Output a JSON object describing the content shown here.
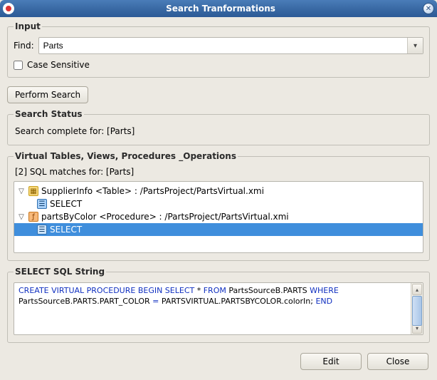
{
  "window": {
    "title": "Search Tranformations"
  },
  "input": {
    "legend": "Input",
    "find_label": "Find:",
    "find_value": "Parts",
    "case_sensitive_label": "Case Sensitive",
    "case_sensitive_checked": false
  },
  "perform_search_label": "Perform Search",
  "status": {
    "legend": "Search Status",
    "text": "Search complete for: [Parts]"
  },
  "results": {
    "legend": "Virtual Tables, Views, Procedures _Operations",
    "summary": "[2] SQL matches for: [Parts]",
    "items": [
      {
        "label": "SupplierInfo <Table>   : /PartsProject/PartsVirtual.xmi",
        "child_label": "SELECT",
        "icon": "table"
      },
      {
        "label": "partsByColor <Procedure>   : /PartsProject/PartsVirtual.xmi",
        "child_label": "SELECT",
        "icon": "procedure"
      }
    ]
  },
  "sql": {
    "legend": "SELECT SQL String",
    "tokens": {
      "k1": "CREATE VIRTUAL PROCEDURE BEGIN SELECT",
      "t1": " * ",
      "k2": "FROM",
      "t2": " PartsSourceB.PARTS ",
      "k3": "WHERE",
      "t3": " PartsSourceB.PARTS.PART_COLOR ",
      "eq": "=",
      "t4": " PARTSVIRTUAL.PARTSBYCOLOR.colorIn; ",
      "k4": "END"
    }
  },
  "footer": {
    "edit_label": "Edit",
    "close_label": "Close"
  }
}
